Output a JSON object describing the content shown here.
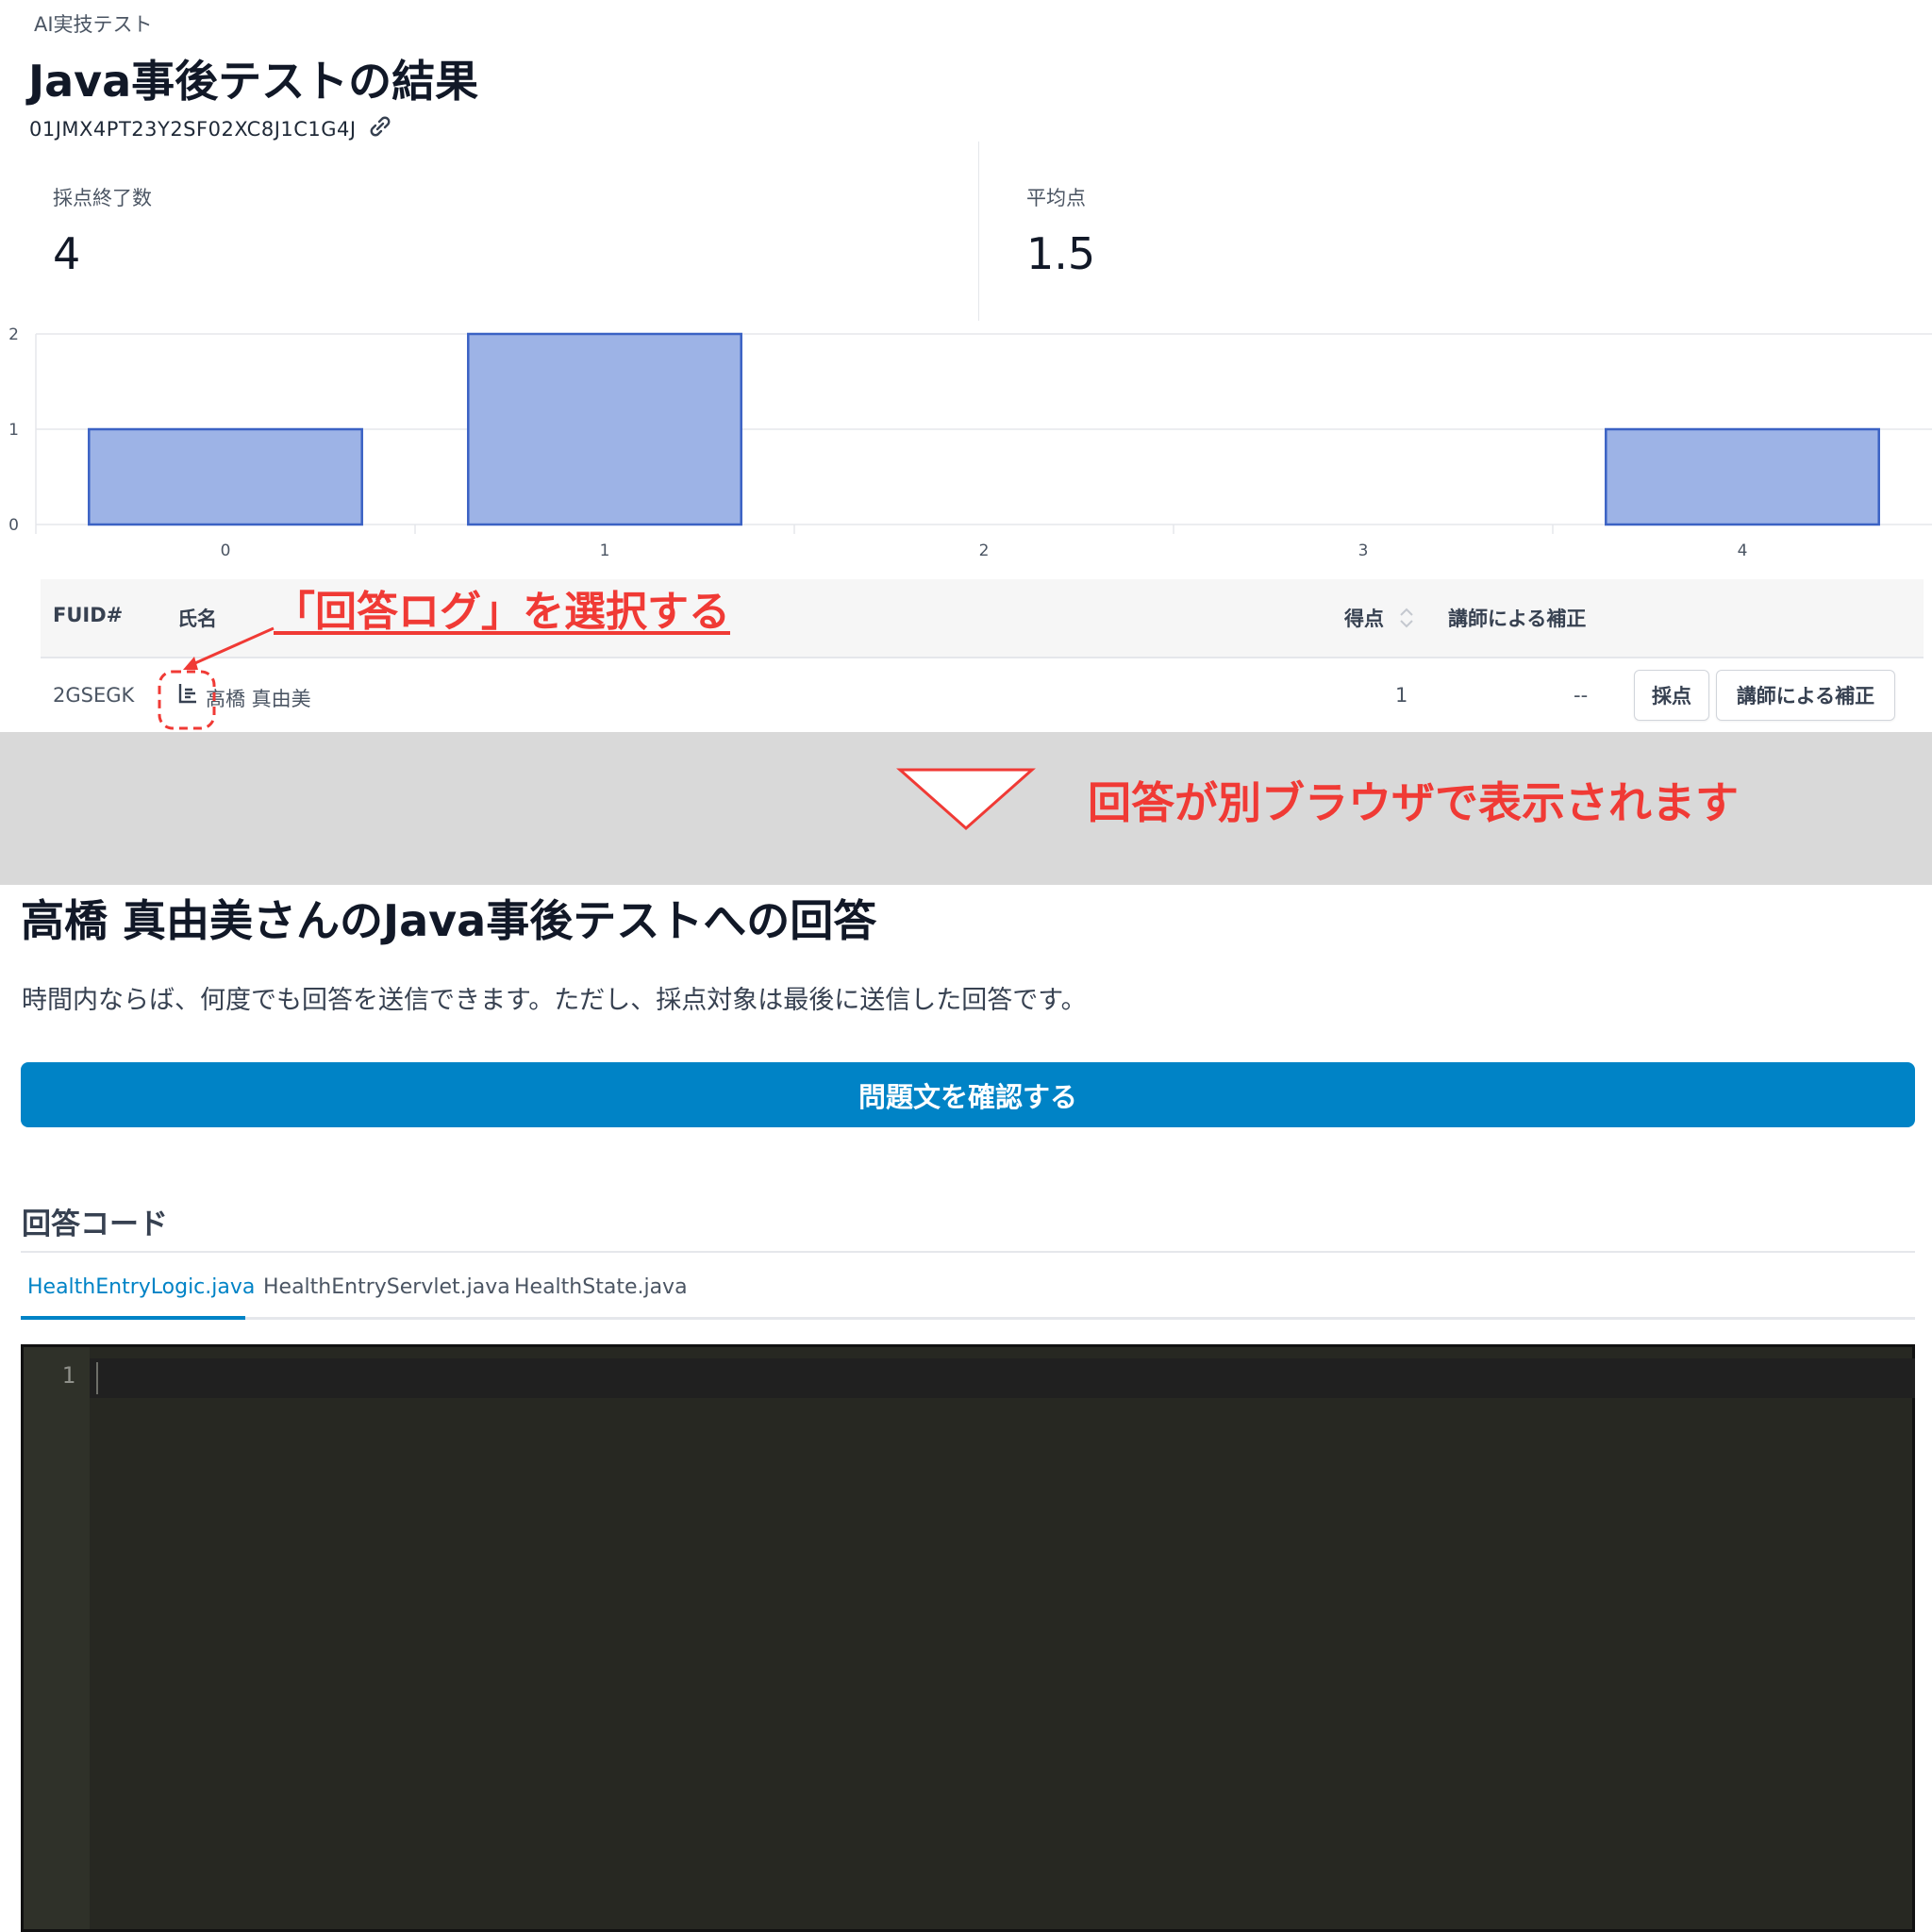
{
  "results_page": {
    "breadcrumb": "AI実技テスト",
    "title": "Java事後テストの結果",
    "test_id": "01JMX4PT23Y2SF02XC8J1C1G4J",
    "stats": {
      "completed_label": "採点終了数",
      "completed_value": "4",
      "average_label": "平均点",
      "average_value": "1.5"
    }
  },
  "chart_data": {
    "type": "bar",
    "categories": [
      "0",
      "1",
      "2",
      "3",
      "4"
    ],
    "values": [
      1,
      2,
      0,
      0,
      1
    ],
    "ylim": [
      0,
      2
    ],
    "yticks": [
      "0",
      "1",
      "2"
    ],
    "grid": true,
    "bar_color": "#9db3e6",
    "bar_border_color": "#3b62c4"
  },
  "table": {
    "headers": {
      "fuid": "FUID#",
      "name": "氏名",
      "score": "得点",
      "correction": "講師による補正"
    },
    "rows": [
      {
        "fuid": "2GSEGK",
        "name": "高橋 真由美",
        "score": "1",
        "correction": "--",
        "grade_button": "採点",
        "correction_button": "講師による補正"
      }
    ]
  },
  "annotations": {
    "select_log": "「回答ログ」を選択する",
    "opens_in_browser": "回答が別ブラウザで表示されます",
    "color": "#f03a35"
  },
  "answer_page": {
    "title": "高橋 真由美さんのJava事後テストへの回答",
    "description": "時間内ならば、何度でも回答を送信できます。ただし、採点対象は最後に送信した回答です。",
    "confirm_button": "問題文を確認する",
    "code_heading": "回答コード",
    "tabs": [
      "HealthEntryLogic.java",
      "HealthEntryServlet.java",
      "HealthState.java"
    ],
    "active_tab": "HealthEntryLogic.java",
    "editor": {
      "line_numbers": [
        "1"
      ]
    },
    "accent_color": "#0083c6"
  }
}
